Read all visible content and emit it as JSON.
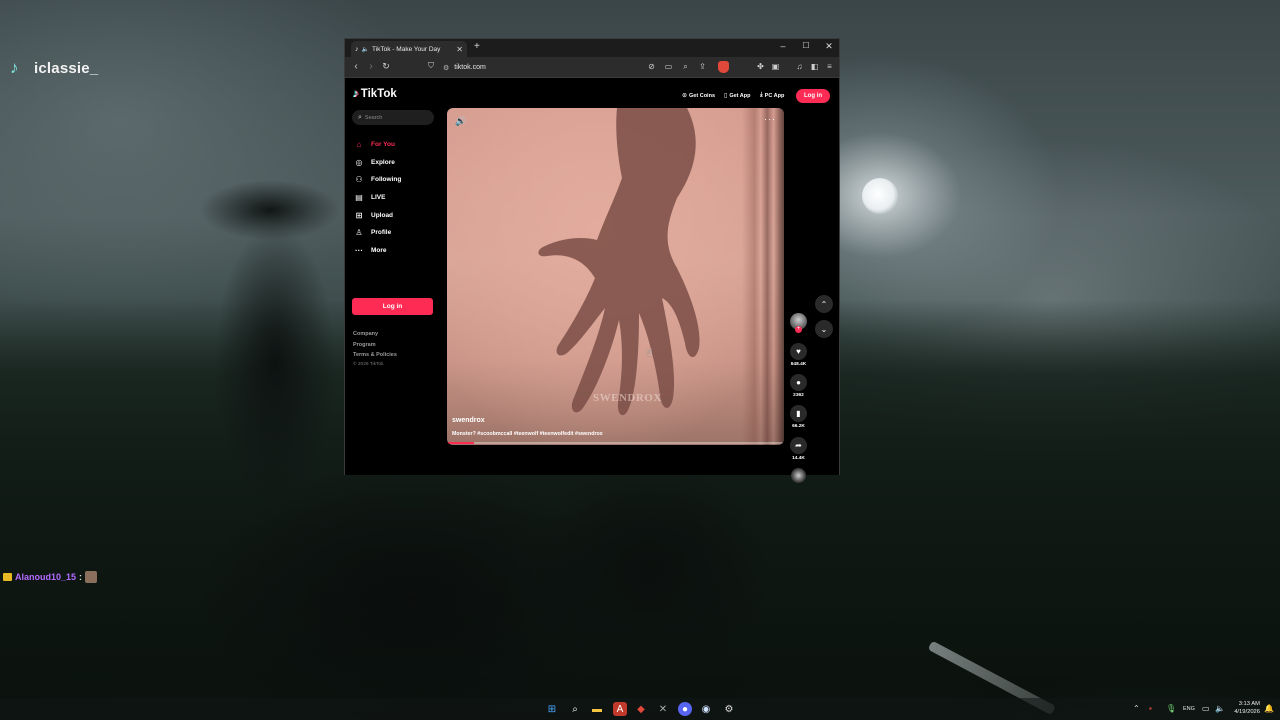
{
  "stream": {
    "streamer_name": "iclassie_",
    "chat": {
      "user": "Alanoud10_15",
      "separator": ":"
    }
  },
  "browser": {
    "tab_title": "TikTok - Make Your Day",
    "url": "tiktok.com",
    "icons": {
      "tab_favicon": "tiktok-icon",
      "audio": "speaker-icon",
      "new_tab": "plus-icon",
      "minimize": "minimize-icon",
      "maximize": "maximize-icon",
      "close": "close-icon"
    }
  },
  "tiktok": {
    "logo": "TikTok",
    "header": {
      "get_coins": "Get Coins",
      "get_app": "Get App",
      "pc_app": "PC App",
      "login": "Log in"
    },
    "search_placeholder": "Search",
    "nav": [
      {
        "label": "For You",
        "icon": "home-icon",
        "active": true
      },
      {
        "label": "Explore",
        "icon": "compass-icon",
        "active": false
      },
      {
        "label": "Following",
        "icon": "following-icon",
        "active": false
      },
      {
        "label": "LIVE",
        "icon": "live-icon",
        "active": false
      },
      {
        "label": "Upload",
        "icon": "upload-icon",
        "active": false
      },
      {
        "label": "Profile",
        "icon": "profile-icon",
        "active": false
      },
      {
        "label": "More",
        "icon": "more-icon",
        "active": false
      }
    ],
    "sidebar_login": "Log in",
    "footer": {
      "company": "Company",
      "program": "Program",
      "terms": "Terms & Policies",
      "copyright": "© 2026 TikTok"
    },
    "video": {
      "username": "swendrox",
      "caption": "Monster? #scoobmccall #teenwolf #teenwolfedit #swendrox",
      "watermark": "SWENDROX",
      "progress": 0.08
    },
    "actions": {
      "likes": "648.4K",
      "comments": "2362",
      "saves": "66.2K",
      "shares": "14.4K"
    }
  },
  "taskbar": {
    "language": "ENG",
    "time": "3:13 AM",
    "date": "4/19/2026"
  },
  "colors": {
    "tiktok_accent": "#fe2c55",
    "page_bg": "#000000",
    "chat_user": "#b36bff"
  }
}
